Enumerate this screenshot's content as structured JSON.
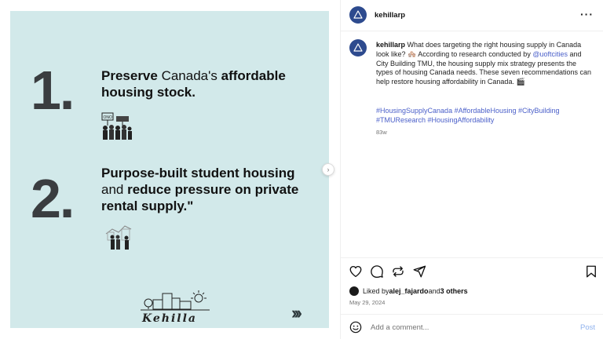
{
  "post": {
    "slide1": {
      "number": "1.",
      "parts": [
        {
          "text": "Preserve ",
          "weight": "bold"
        },
        {
          "text": "Canada's ",
          "weight": "light"
        },
        {
          "text": "affordable housing stock.",
          "weight": "bold"
        }
      ]
    },
    "slide2": {
      "number": "2.",
      "parts": [
        {
          "text": "Purpose-built student housing ",
          "weight": "bold"
        },
        {
          "text": "and ",
          "weight": "light"
        },
        {
          "text": "reduce pressure on private ",
          "weight": "bold"
        },
        {
          "text": "rental supply.\"",
          "weight": "bold"
        }
      ]
    },
    "sign_text": "ONO",
    "logo_text": "Kehilla",
    "next_arrows": "›››",
    "colors": {
      "background": "#d2e9ea",
      "number": "#3a3d40"
    }
  },
  "header": {
    "username": "kehillarp",
    "more_icon": "more-horizontal-icon"
  },
  "caption": {
    "username": "kehillarp",
    "text_before_mention": "What does targeting the right housing supply in Canada look like? 🏘️ According to research conducted by ",
    "mention": "@uoftcities",
    "text_after_mention": " and City Building TMU, the housing supply mix strategy presents the types of housing Canada needs. These seven recommendations can help restore housing affordability in Canada. 🎬",
    "hashtags": "#HousingSupplyCanada #AffordableHousing #CityBuilding #TMUResearch #HousingAffordability",
    "age": "83w"
  },
  "actions": {
    "liked_prefix": "Liked by ",
    "liked_user": "alej_fajardo",
    "liked_mid": " and ",
    "liked_others": "3 others",
    "date": "May 29, 2024"
  },
  "comment": {
    "placeholder": "Add a comment...",
    "post_label": "Post"
  },
  "colors": {
    "accent_link": "#4a5fc9",
    "post_button": "#8fb2ee",
    "avatar": "#2d4a8e"
  }
}
